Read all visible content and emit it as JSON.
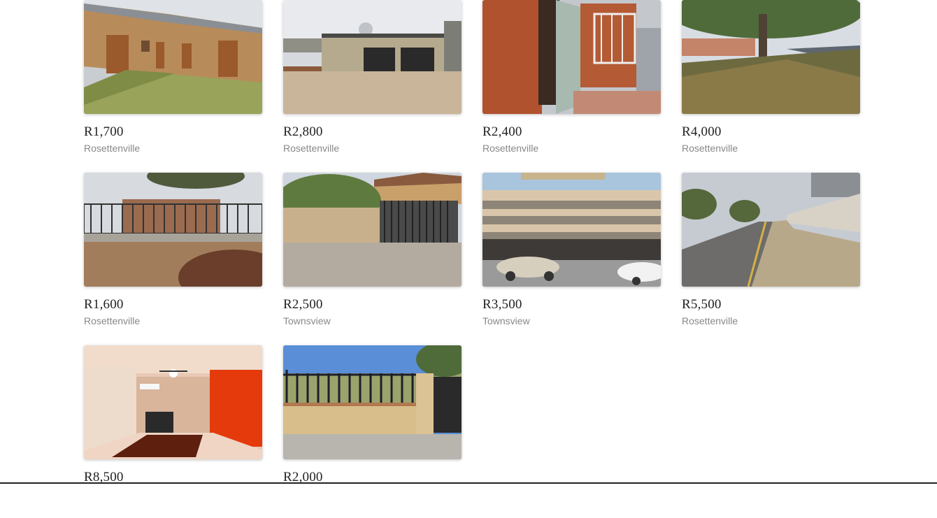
{
  "listings": [
    {
      "price": "R1,700",
      "suburb": "Rosettenville",
      "photo": "brick-house-icon"
    },
    {
      "price": "R2,800",
      "suburb": "Rosettenville",
      "photo": "garage-house-icon"
    },
    {
      "price": "R2,400",
      "suburb": "Rosettenville",
      "photo": "brick-doorway-icon"
    },
    {
      "price": "R4,000",
      "suburb": "Rosettenville",
      "photo": "tree-lawn-icon"
    },
    {
      "price": "R1,600",
      "suburb": "Rosettenville",
      "photo": "fenced-house-icon"
    },
    {
      "price": "R2,500",
      "suburb": "Townsview",
      "photo": "gate-driveway-icon"
    },
    {
      "price": "R3,500",
      "suburb": "Townsview",
      "photo": "apartment-block-icon"
    },
    {
      "price": "R5,500",
      "suburb": "Rosettenville",
      "photo": "street-view-icon"
    },
    {
      "price": "R8,500",
      "suburb": "",
      "photo": "interior-room-icon"
    },
    {
      "price": "R2,000",
      "suburb": "",
      "photo": "wall-fence-icon"
    }
  ]
}
